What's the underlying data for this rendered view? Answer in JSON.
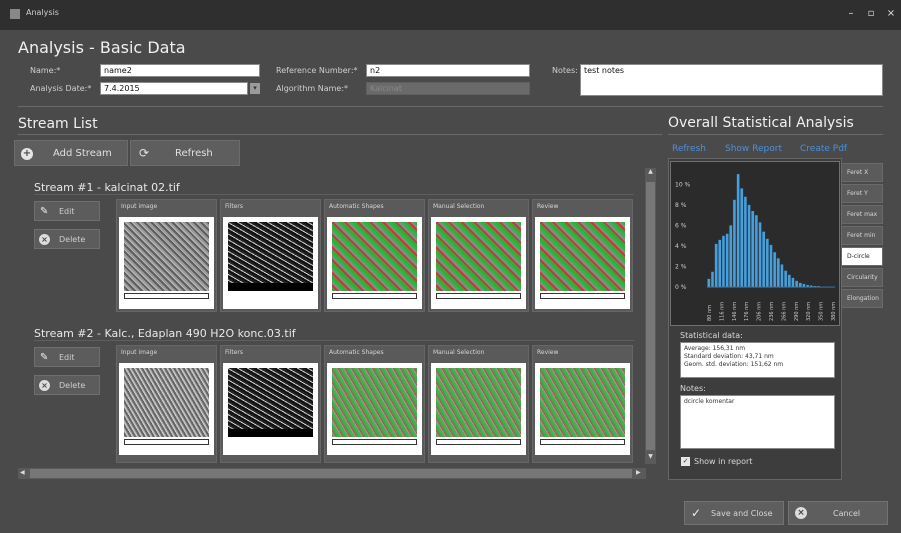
{
  "window": {
    "title": "Analysis"
  },
  "header": {
    "title": "Analysis - Basic Data"
  },
  "form": {
    "name_label": "Name:*",
    "name_value": "name2",
    "date_label": "Analysis Date:*",
    "date_value": "7.4.2015",
    "ref_label": "Reference Number:*",
    "ref_value": "n2",
    "algo_label": "Algorithm Name:*",
    "algo_value": "Kalcinat",
    "notes_label": "Notes:",
    "notes_value": "test notes"
  },
  "stream_list": {
    "title": "Stream List",
    "add_label": "Add Stream",
    "refresh_label": "Refresh",
    "columns": [
      "Input image",
      "Filters",
      "Automatic Shapes",
      "Manual Selection",
      "Review"
    ],
    "edit_label": "Edit",
    "delete_label": "Delete",
    "streams": [
      {
        "title": "Stream #1 - kalcinat 02.tif"
      },
      {
        "title": "Stream #2 - Kalc., Edaplan 490 H2O konc.03.tif"
      }
    ]
  },
  "stats": {
    "title": "Overall Statistical Analysis",
    "links": [
      "Refresh",
      "Show Report",
      "Create Pdf"
    ],
    "tabs": [
      "Feret X",
      "Feret Y",
      "Feret max",
      "Feret min",
      "D-circle",
      "Circularity",
      "Elongation"
    ],
    "active_tab": "D-circle",
    "statistical_label": "Statistical data:",
    "stat_lines": [
      "Average: 156,31 nm",
      "Standard deviation: 43,71 nm",
      "Geom. std. deviation: 151,62 nm"
    ],
    "notes_label": "Notes:",
    "notes_value": "dcircle komentar",
    "show_in_report": "Show in report"
  },
  "chart_data": {
    "type": "bar",
    "ylim": [
      0,
      11
    ],
    "ytick_labels": [
      "0 %",
      "2 %",
      "4 %",
      "6 %",
      "8 %",
      "10 %"
    ],
    "xtick_labels": [
      "80 nm",
      "116 nm",
      "146 nm",
      "176 nm",
      "206 nm",
      "236 nm",
      "266 nm",
      "290 nm",
      "320 nm",
      "350 nm",
      "380 nm"
    ],
    "values": [
      0.8,
      1.5,
      4.2,
      4.6,
      5.0,
      5.2,
      6.0,
      8.5,
      11.0,
      9.6,
      8.8,
      8.0,
      7.4,
      7.0,
      6.3,
      5.4,
      4.7,
      4.1,
      3.4,
      2.8,
      2.2,
      1.6,
      1.2,
      0.9,
      0.6,
      0.4,
      0.3,
      0.2,
      0.15,
      0.1,
      0.1,
      0.05,
      0.05,
      0.05,
      0.05
    ],
    "bar_color": "#4a9fd8"
  },
  "footer": {
    "save_label": "Save and Close",
    "cancel_label": "Cancel"
  }
}
